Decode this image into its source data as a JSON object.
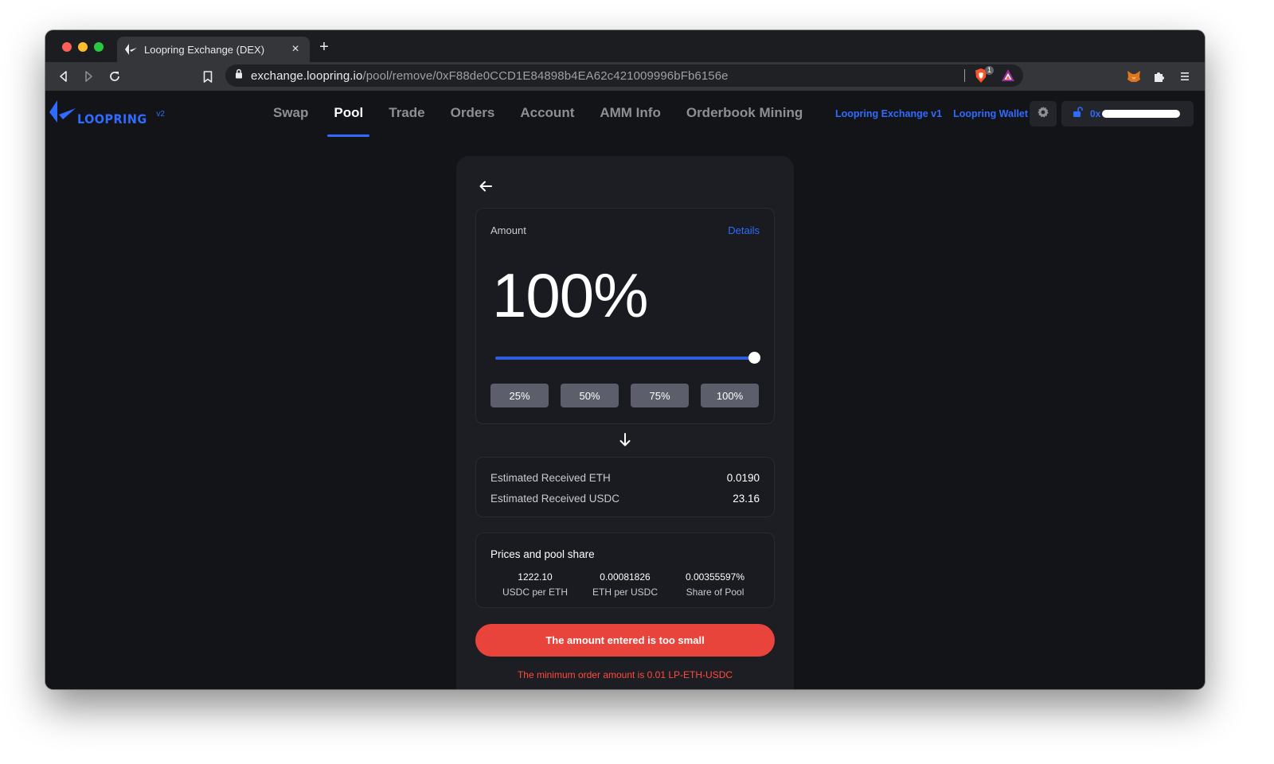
{
  "browser": {
    "tab_title": "Loopring Exchange (DEX)",
    "url_host": "exchange.loopring.io",
    "url_path": "/pool/remove/0xF88de0CCD1E84898b4EA62c421009996bFb6156e",
    "shield_count": "1",
    "icons": [
      "back-icon",
      "forward-icon",
      "reload-icon",
      "bookmark-icon",
      "lock-icon",
      "brave-shield-icon",
      "brave-rewards-icon",
      "metamask-icon",
      "extensions-icon",
      "menu-icon"
    ]
  },
  "header": {
    "logo_text": "LOOPRING",
    "logo_version": "v2",
    "nav": [
      {
        "label": "Swap"
      },
      {
        "label": "Pool",
        "active": true
      },
      {
        "label": "Trade"
      },
      {
        "label": "Orders"
      },
      {
        "label": "Account"
      },
      {
        "label": "AMM Info"
      },
      {
        "label": "Orderbook Mining"
      }
    ],
    "link_v1": "Loopring Exchange v1",
    "link_wallet": "Loopring Wallet",
    "wallet_prefix": "0x"
  },
  "remove": {
    "amount_label": "Amount",
    "details_label": "Details",
    "percent": "100%",
    "slider_value": 1.0,
    "quick": [
      "25%",
      "50%",
      "75%",
      "100%"
    ],
    "estimated": [
      {
        "label": "Estimated Received ETH",
        "value": "0.0190"
      },
      {
        "label": "Estimated Received USDC",
        "value": "23.16"
      }
    ],
    "prices_title": "Prices and pool share",
    "prices": [
      {
        "value": "1222.10",
        "label": "USDC per ETH"
      },
      {
        "value": "0.00081826",
        "label": "ETH per USDC"
      },
      {
        "value": "0.00355597%",
        "label": "Share of Pool"
      }
    ],
    "error_button": "The amount entered is too small",
    "error_note": "The minimum order amount is 0.01 LP-ETH-USDC"
  },
  "colors": {
    "accent": "#2f6bff",
    "error": "#e8443c",
    "background": "#131418",
    "card": "#1d1e23"
  }
}
